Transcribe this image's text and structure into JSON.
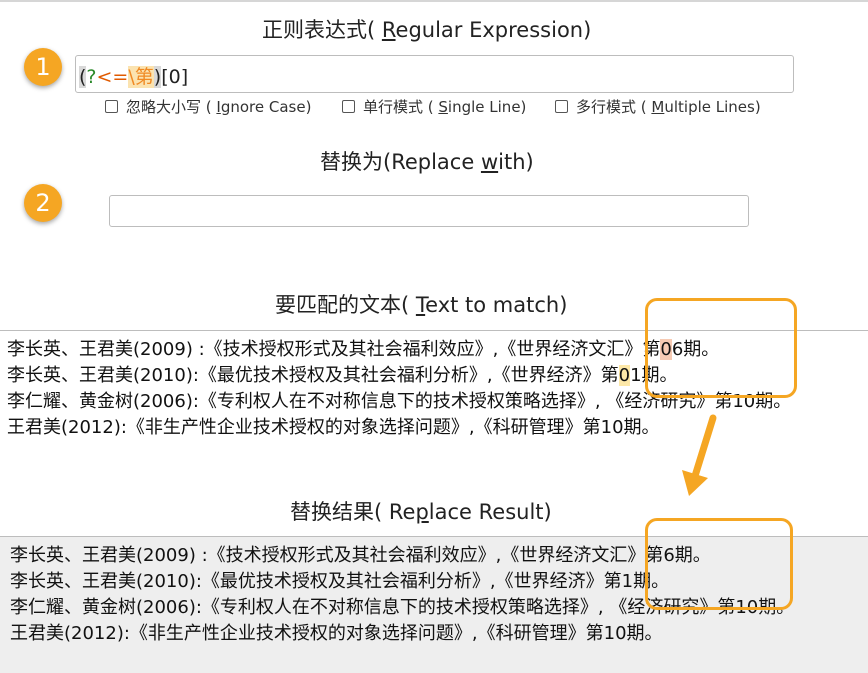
{
  "regex_section": {
    "title_prefix": "正则表达式( ",
    "title_underlined": "R",
    "title_suffix": "egular Expression)",
    "badge": "1",
    "pattern": {
      "open_paren": "(",
      "lookbehind_q": "?",
      "lookbehind_lt": "<=",
      "escaped": "\\第",
      "close_paren": ")",
      "char_class": "[0]"
    },
    "options": [
      {
        "label_prefix": "忽略大小写 ( ",
        "underlined": "I",
        "label_suffix": "gnore Case)"
      },
      {
        "label_prefix": "单行模式 ( ",
        "underlined": "S",
        "label_suffix": "ingle Line)"
      },
      {
        "label_prefix": "多行模式 ( ",
        "underlined": "M",
        "label_suffix": "ultiple Lines)"
      }
    ]
  },
  "replace_section": {
    "title_prefix": "替换为(Replace ",
    "title_underlined": "w",
    "title_suffix": "ith)",
    "badge": "2",
    "value": ""
  },
  "match_section": {
    "title_prefix": "要匹配的文本( ",
    "title_underlined": "T",
    "title_suffix": "ext to match)",
    "lines": [
      {
        "before": "李长英、王君美(2009) :《技术授权形式及其社会福利效应》,《世界经济文汇》第",
        "match": "0",
        "after": "6期。"
      },
      {
        "before": "李长英、王君美(2010):《最优技术授权及其社会福利分析》,《世界经济》第",
        "match": "0",
        "after": "1期。"
      },
      {
        "before": "李仁耀、黄金树(2006):《专利权人在不对称信息下的技术授权策略选择》, 《经济研究》第10期。",
        "match": "",
        "after": ""
      },
      {
        "before": "王君美(2012):《非生产性企业技术授权的对象选择问题》,《科研管理》第10期。",
        "match": "",
        "after": ""
      }
    ]
  },
  "result_section": {
    "title_prefix": "替换结果( Re",
    "title_underlined": "p",
    "title_suffix": "lace Result)",
    "lines": [
      "李长英、王君美(2009) :《技术授权形式及其社会福利效应》,《世界经济文汇》第6期。",
      "李长英、王君美(2010):《最优技术授权及其社会福利分析》,《世界经济》第1期。",
      "李仁耀、黄金树(2006):《专利权人在不对称信息下的技术授权策略选择》, 《经济研究》第10期。",
      "王君美(2012):《非生产性企业技术授权的对象选择问题》,《科研管理》第10期。"
    ]
  },
  "colors": {
    "accent": "#f5a623",
    "result_bg": "#eeeeee"
  }
}
